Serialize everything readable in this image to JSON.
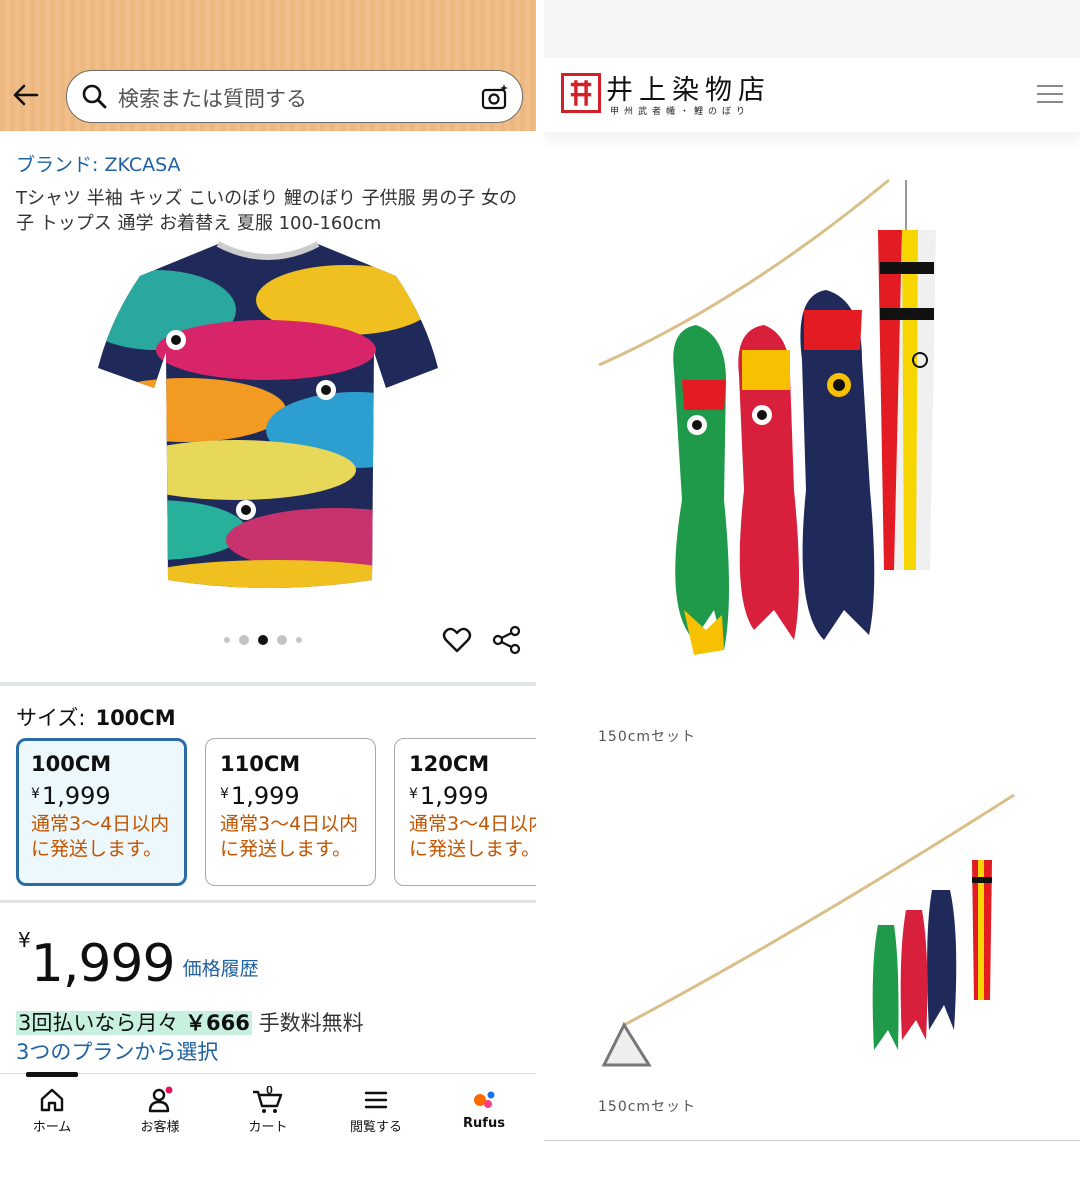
{
  "left_app": {
    "search": {
      "placeholder": "検索または質問する"
    },
    "product": {
      "brand": "ブランド: ZKCASA",
      "title": "Tシャツ 半袖 キッズ こいのぼり 鯉のぼり 子供服 男の子 女の子 トップス 通学 お着替え 夏服 100-160cm",
      "image_count": 5,
      "current_image_index": 3
    },
    "size": {
      "label": "サイズ:",
      "selected": "100CM",
      "options": [
        {
          "name": "100CM",
          "yen": "¥",
          "price": "1,999",
          "ship1": "通常3～4日以内",
          "ship2": "に発送します。",
          "selected": true
        },
        {
          "name": "110CM",
          "yen": "¥",
          "price": "1,999",
          "ship1": "通常3～4日以内",
          "ship2": "に発送します。",
          "selected": false
        },
        {
          "name": "120CM",
          "yen": "¥",
          "price": "1,999",
          "ship1": "通常3～4日以内",
          "ship2": "に発送します。",
          "selected": false
        }
      ]
    },
    "price": {
      "yen": "¥",
      "amount": "1,999",
      "history_link": "価格履歴"
    },
    "installment": {
      "text": "3回払いなら月々",
      "amount": "￥666",
      "fee": "手数料無料",
      "plans_link": "3つのプランから選択"
    },
    "bottom_nav": [
      {
        "label": "ホーム",
        "icon": "home-icon",
        "active": true
      },
      {
        "label": "お客様",
        "icon": "account-icon",
        "badge": true
      },
      {
        "label": "カート",
        "icon": "cart-icon",
        "count": "0"
      },
      {
        "label": "閲覧する",
        "icon": "menu-icon"
      },
      {
        "label": "Rufus",
        "icon": "rufus-icon"
      }
    ],
    "colors": {
      "header": "#edb780",
      "link": "#2162a1",
      "shipping": "#c45500",
      "selected_border": "#2b6ba8",
      "installment_highlight": "#c8f0df"
    }
  },
  "right_app": {
    "shop_name": "井上染物店",
    "shop_subtitle": "甲州武者幟・鯉のぼり",
    "images": [
      {
        "caption": "150cmセット"
      },
      {
        "caption": "150cmセット"
      }
    ],
    "colors": {
      "logo": "#d4202a"
    }
  }
}
